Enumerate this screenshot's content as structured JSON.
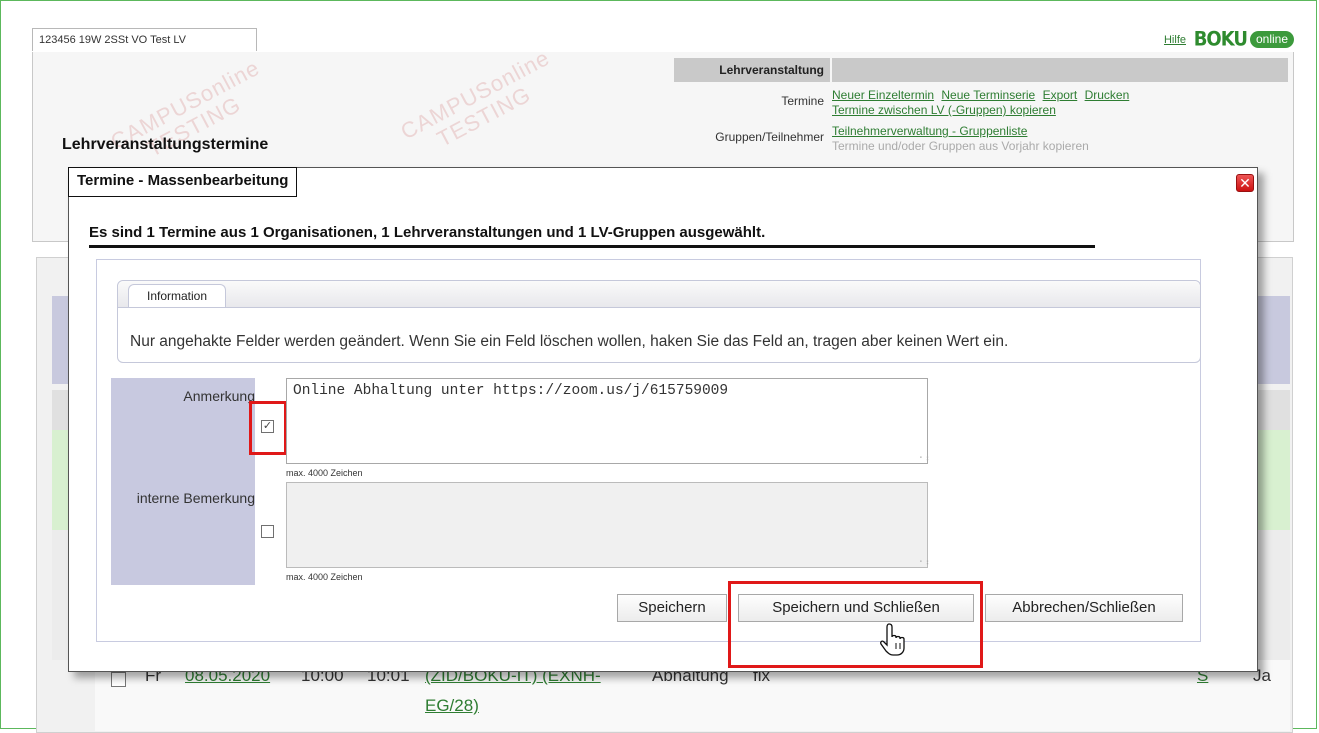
{
  "window": {
    "tab_label": "123456 19W 2SSt VO Test LV",
    "help_link": "Hilfe",
    "logo_text": "BOKU",
    "logo_badge": "online",
    "brand_color": "#3c9a3c"
  },
  "page": {
    "title": "Lehrveranstaltungstermine",
    "watermark_1": "CAMPUSonline",
    "watermark_2": "TESTING"
  },
  "lv_panel": {
    "header": "Lehrveranstaltung",
    "rows": [
      {
        "label": "Termine",
        "links": [
          "Neuer Einzeltermin",
          "Neue Terminserie",
          "Export",
          "Drucken"
        ],
        "links2": [
          "Termine zwischen LV (-Gruppen) kopieren"
        ]
      },
      {
        "label": "Gruppen/Teilnehmer",
        "links": [
          "Teilnehmerverwaltung - Gruppenliste"
        ],
        "dim": "Termine und/oder Gruppen aus Vorjahr kopieren"
      }
    ]
  },
  "background_row": {
    "day": "Fr",
    "date": "08.05.2020",
    "start": "10:00",
    "end": "10:01",
    "location_1": "(ZID/BOKU-IT) (EXNH-",
    "location_2": "EG/28)",
    "type": "Abhaltung",
    "fix": "fix",
    "s_link": "S",
    "ja": "Ja"
  },
  "modal": {
    "title": "Termine - Massenbearbeitung",
    "close_icon": "close-icon",
    "selection_info": "Es sind 1 Termine aus 1 Organisationen, 1 Lehrveranstaltungen und 1 LV-Gruppen ausgewählt.",
    "info_legend": "Information",
    "info_text": "Nur angehakte Felder werden geändert. Wenn Sie ein Feld löschen wollen, haken Sie das Feld an, tragen aber keinen Wert ein.",
    "fields": {
      "anmerkung": {
        "label": "Anmerkung",
        "checked": true,
        "value": "Online Abhaltung unter https://zoom.us/j/615759009",
        "hint": "max. 4000 Zeichen"
      },
      "interne_bemerkung": {
        "label": "interne Bemerkung",
        "checked": false,
        "value": "",
        "hint": "max. 4000 Zeichen"
      }
    },
    "buttons": {
      "save": "Speichern",
      "save_close": "Speichern und Schließen",
      "cancel": "Abbrechen/Schließen"
    },
    "highlight_color": "#e01818"
  }
}
